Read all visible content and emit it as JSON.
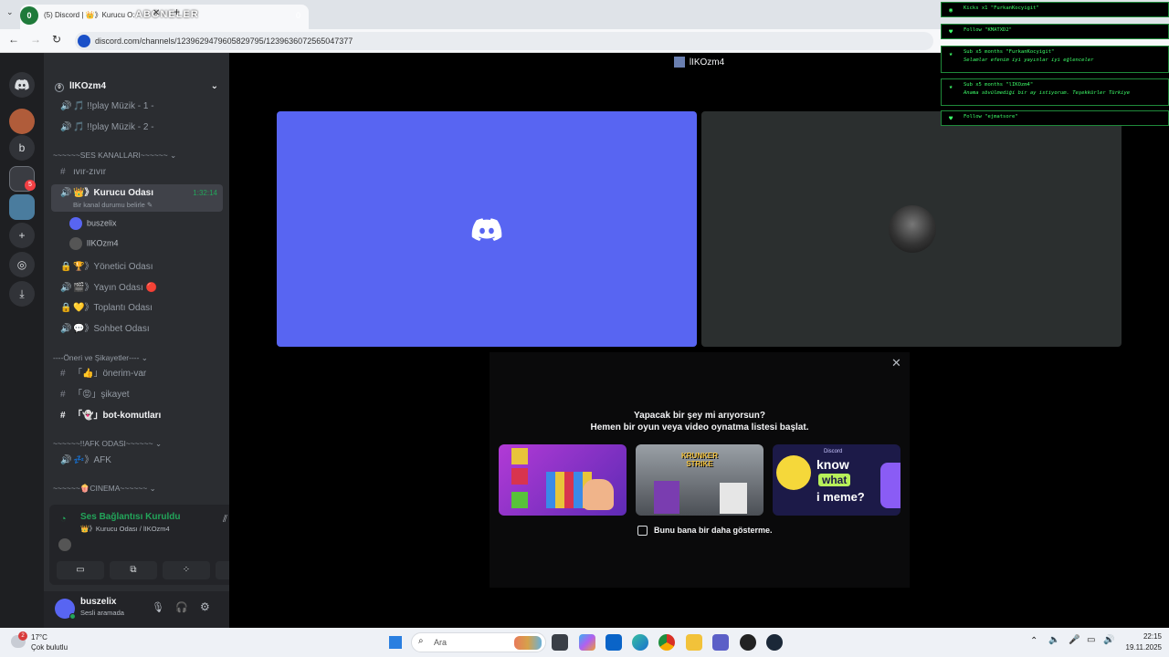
{
  "browser": {
    "tab_title": "(5) Discord | 👑》Kurucu O:",
    "tab_badge": "0",
    "tab_overlay_text": "ABONELER",
    "tab_overlay_count": "0",
    "url": "discord.com/channels/1239629479605829795/1239636072565047377"
  },
  "server": {
    "name": "lIKOzm4",
    "icon_b": "b",
    "badge": "5"
  },
  "channels": [
    {
      "icon": "🔊",
      "label": "🎵 !!play Müzik - 1 -"
    },
    {
      "icon": "🔊",
      "label": "🎵 !!play Müzik - 2 -"
    },
    {
      "kind": "category",
      "label": "~~~~~~SES KANALLARI~~~~~~ ⌄"
    },
    {
      "icon": "#",
      "label": "ıvır-zıvır"
    },
    {
      "icon": "🔊",
      "label": "👑》Kurucu Odası",
      "time": "1:32:14",
      "sub": "Bir kanal durumu belirle ✎"
    },
    {
      "kind": "user",
      "label": "buszelix"
    },
    {
      "kind": "user",
      "label": "lIKOzm4"
    },
    {
      "icon": "🔒",
      "label": "🏆》Yönetici Odası"
    },
    {
      "icon": "🔊",
      "label": "🎬》Yayın Odası 🔴"
    },
    {
      "icon": "🔒",
      "label": "💛》Toplantı Odası"
    },
    {
      "icon": "🔊",
      "label": "💬》Sohbet Odası"
    },
    {
      "kind": "category",
      "label": "----Öneri ve Şikayetler---- ⌄"
    },
    {
      "icon": "#",
      "label": "「👍」önerim-var"
    },
    {
      "icon": "#",
      "label": "「😡」şikayet"
    },
    {
      "icon": "#",
      "label": "「👻」bot-komutları"
    },
    {
      "kind": "category",
      "label": "~~~~~~!!AFK ODASI~~~~~~ ⌄"
    },
    {
      "icon": "🔊",
      "label": "💤》AFK"
    },
    {
      "kind": "category",
      "label": "~~~~~~🍿CINEMA~~~~~~ ⌄"
    }
  ],
  "voice": {
    "status": "Ses Bağlantısı Kuruldu",
    "location": "👑》Kurucu Odası / lIKOzm4"
  },
  "user": {
    "name": "buszelix",
    "status": "Sesli aramada"
  },
  "main": {
    "title": "lIKOzm4",
    "activity_title": "Yapacak bir şey mi arıyorsun?",
    "activity_subtitle": "Hemen bir oyun veya video oynatma listesi başlat.",
    "dont_show": "Bunu bana bir daha gösterme.",
    "card3_text_1": "know",
    "card3_text_2": "what",
    "card3_text_3": "i meme?",
    "card3_brand": "Discord",
    "card2_text": "KRUNKER STRIKE"
  },
  "alerts": [
    {
      "text": "Kicks x1 \"FurkanKocyigit\""
    },
    {
      "text": "Follow \"KMATXD2\""
    },
    {
      "text": "Sub x5 months \"FurkanKocyigit\"",
      "msg": "Selamlar efenim iyi yayınlar iyi eğlenceler"
    },
    {
      "text": "Sub x5 months \"lIKOzm4\"",
      "msg": "Anama sövülmediği bir ay istiyorum. Teşekkürler Türkiye"
    },
    {
      "text": "Follow \"ejmatsore\""
    }
  ],
  "taskbar": {
    "weather_temp": "17°C",
    "weather_desc": "Çok bulutlu",
    "weather_badge": "2",
    "search": "Ara",
    "time": "22:15",
    "date": "19.11.2025"
  },
  "colors": {
    "blurple": "#5865f2",
    "alert_green": "#3eff6a",
    "voice_green": "#23a55a"
  }
}
